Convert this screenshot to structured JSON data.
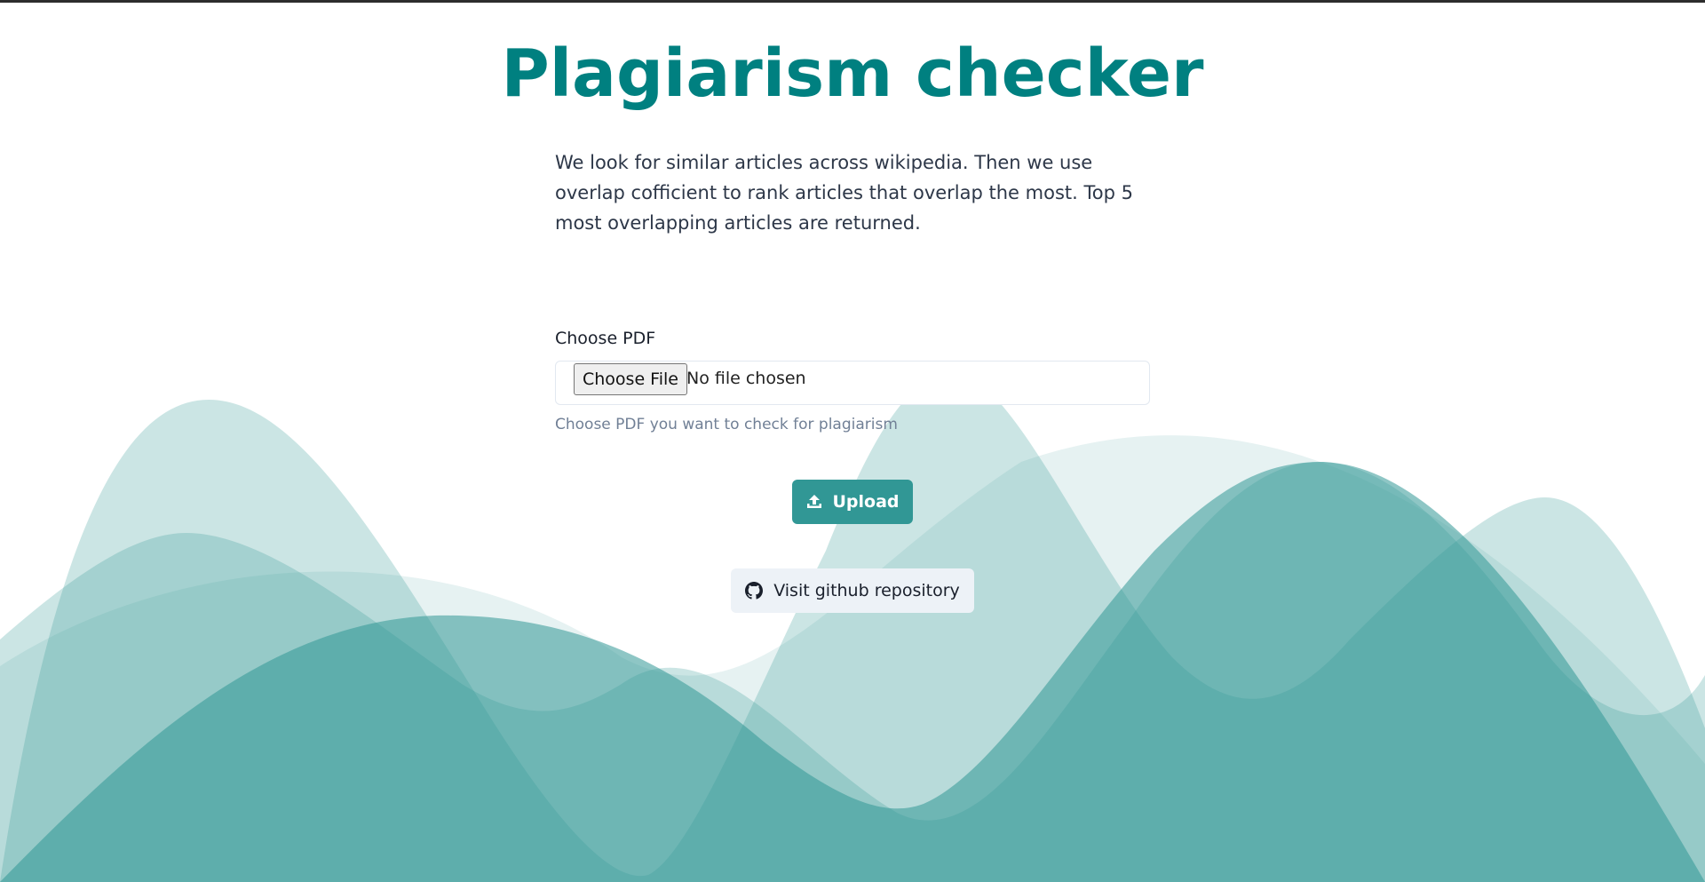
{
  "page": {
    "title": "Plagiarism checker",
    "description": "We look for similar articles across wikipedia. Then we use overlap cofficient to rank articles that overlap the most. Top 5 most overlapping articles are returned."
  },
  "form": {
    "label": "Choose PDF",
    "file_button_label": "Choose File",
    "file_status": "No file chosen",
    "helper_text": "Choose PDF you want to check for plagiarism"
  },
  "actions": {
    "upload_label": "Upload",
    "upload_icon": "upload-icon",
    "github_label": "Visit github repository",
    "github_icon": "github-icon"
  },
  "colors": {
    "title": "#008080",
    "upload_button": "#319795",
    "github_button": "#edf2f7",
    "waves": "#319795"
  }
}
